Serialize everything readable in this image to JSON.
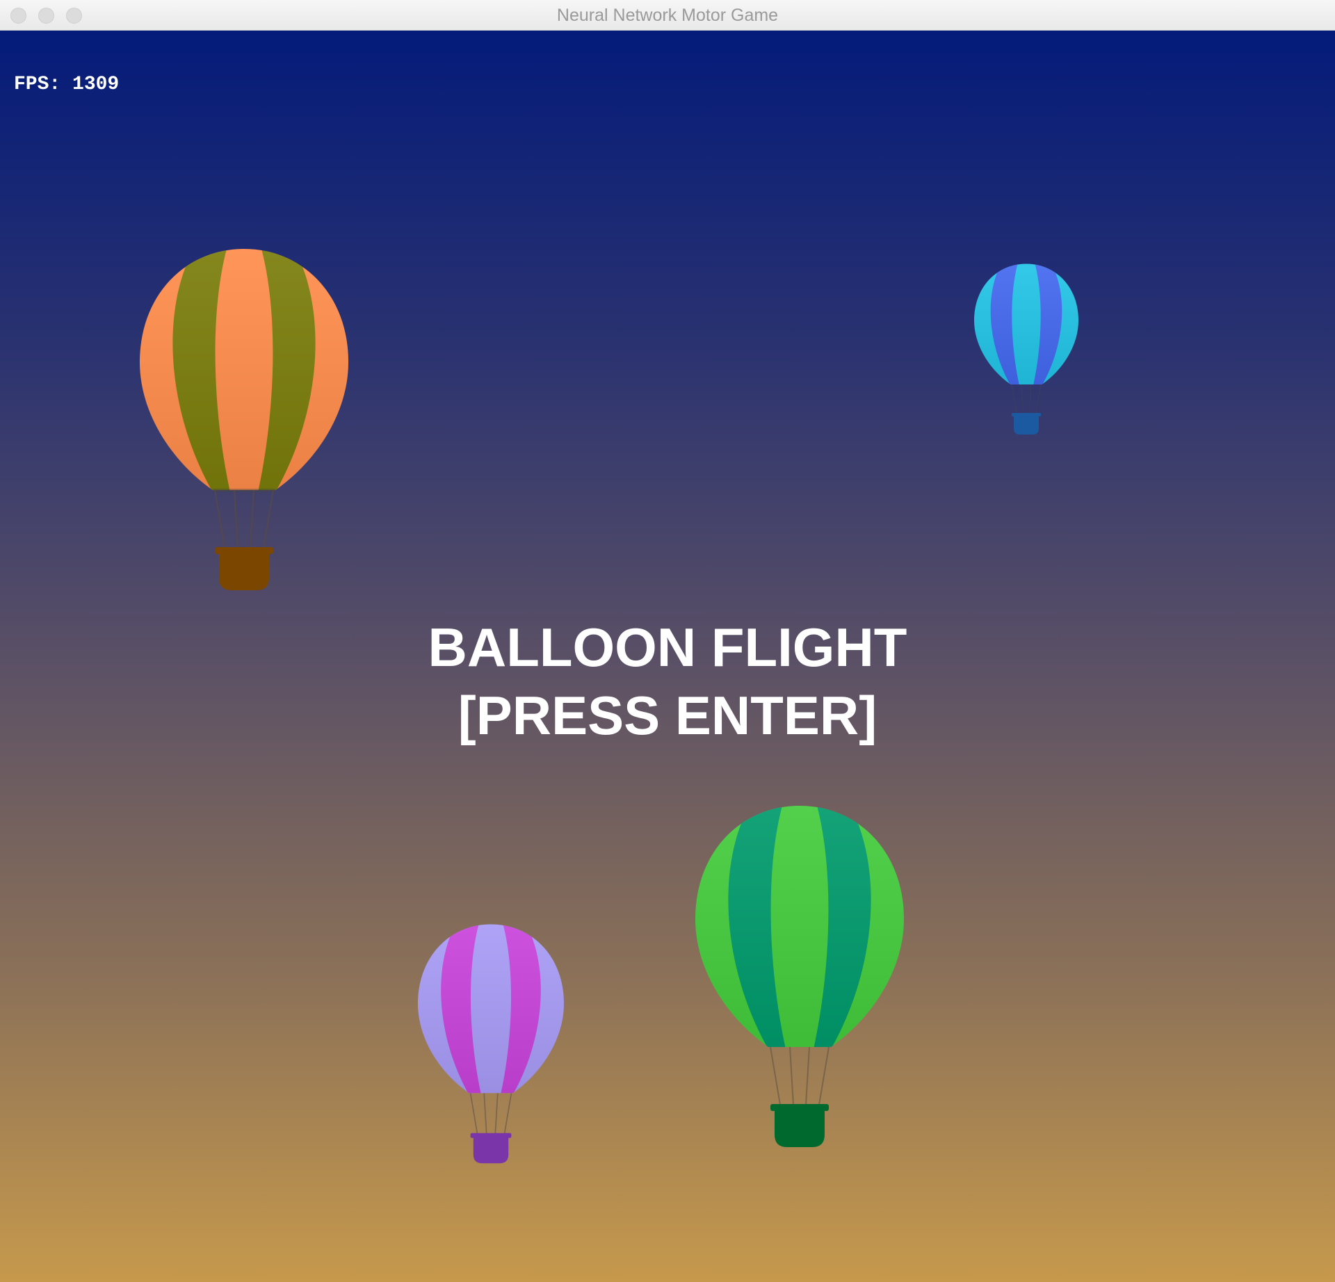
{
  "window": {
    "title": "Neural Network Motor Game"
  },
  "hud": {
    "fps_text": "FPS: 1309"
  },
  "title_screen": {
    "title": "BALLOON FLIGHT",
    "prompt": "[PRESS ENTER]"
  },
  "sky_colors": [
    "#041b7a",
    "#2a3270",
    "#5a5066",
    "#8a7058",
    "#c6994c"
  ],
  "balloons": [
    {
      "name": "orange-olive",
      "stripe_a": "#ff8c4a",
      "stripe_b": "#7a7d0a",
      "basket": "#7a4600"
    },
    {
      "name": "cyan-blue",
      "stripe_a": "#22c4e6",
      "stripe_b": "#4468f0",
      "basket": "#1b5aa0"
    },
    {
      "name": "lavender-magenta",
      "stripe_a": "#a79bf5",
      "stripe_b": "#c843db",
      "basket": "#7a35a8"
    },
    {
      "name": "green-teal",
      "stripe_a": "#44cc3c",
      "stripe_b": "#009a6c",
      "basket": "#006a2e"
    }
  ]
}
